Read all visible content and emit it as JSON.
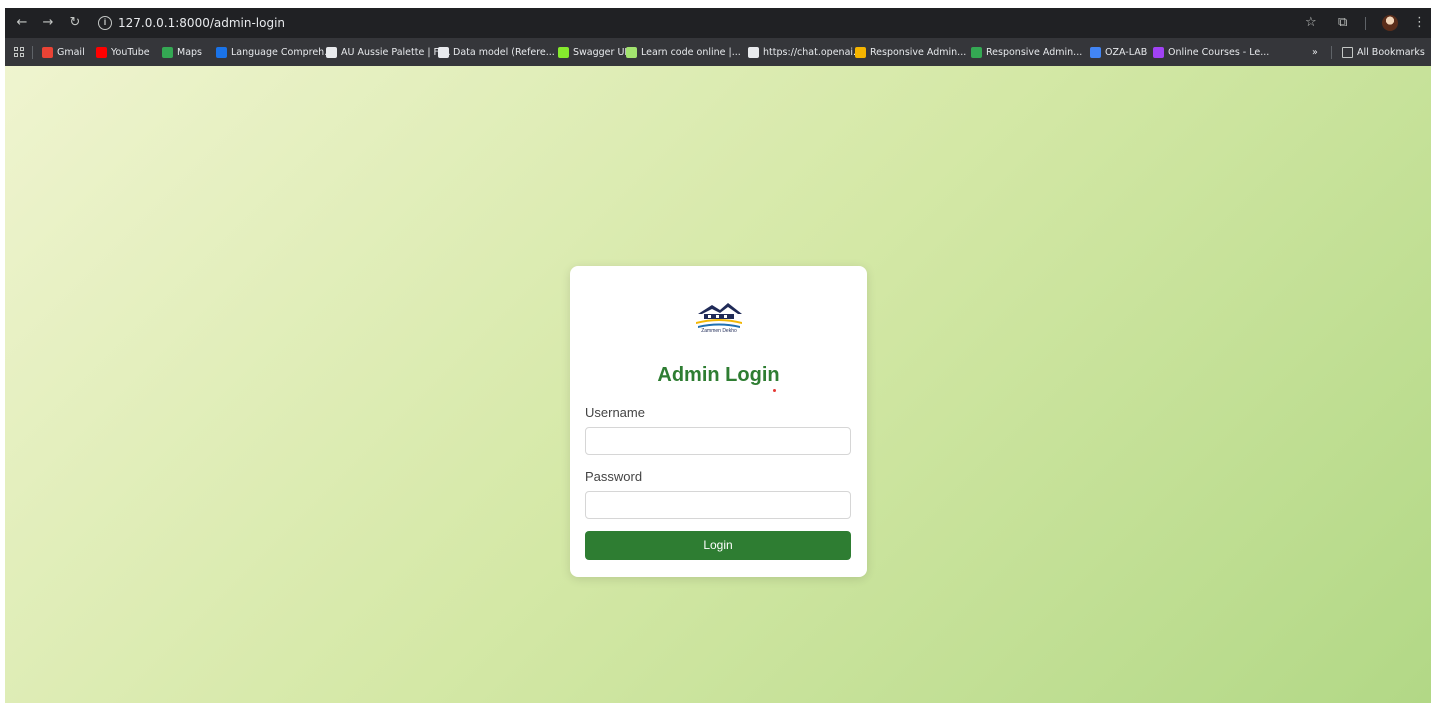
{
  "browser": {
    "url": "127.0.0.1:8000/admin-login",
    "bookmarks": [
      {
        "label": "Gmail",
        "color": "#ea4335"
      },
      {
        "label": "YouTube",
        "color": "#ff0000"
      },
      {
        "label": "Maps",
        "color": "#34a853"
      },
      {
        "label": "Language Compreh...",
        "color": "#1a73e8"
      },
      {
        "label": "AU Aussie Palette | Fl...",
        "color": "#e8eaed"
      },
      {
        "label": "Data model (Refere...",
        "color": "#e8eaed"
      },
      {
        "label": "Swagger UI",
        "color": "#85ea2d"
      },
      {
        "label": "Learn code online |...",
        "color": "#a2e36f"
      },
      {
        "label": "https://chat.openai....",
        "color": "#e8eaed"
      },
      {
        "label": "Responsive Admin...",
        "color": "#f4b400"
      },
      {
        "label": "Responsive Admin...",
        "color": "#34a853"
      },
      {
        "label": "OZA-LAB",
        "color": "#4285f4"
      },
      {
        "label": "Online Courses - Le...",
        "color": "#a142f4"
      }
    ],
    "all_bookmarks": "All Bookmarks"
  },
  "login": {
    "title": "Admin Login",
    "logo_text": "Zammen Dekho",
    "username_label": "Username",
    "password_label": "Password",
    "button": "Login"
  },
  "colors": {
    "accent": "#2e7d32"
  }
}
